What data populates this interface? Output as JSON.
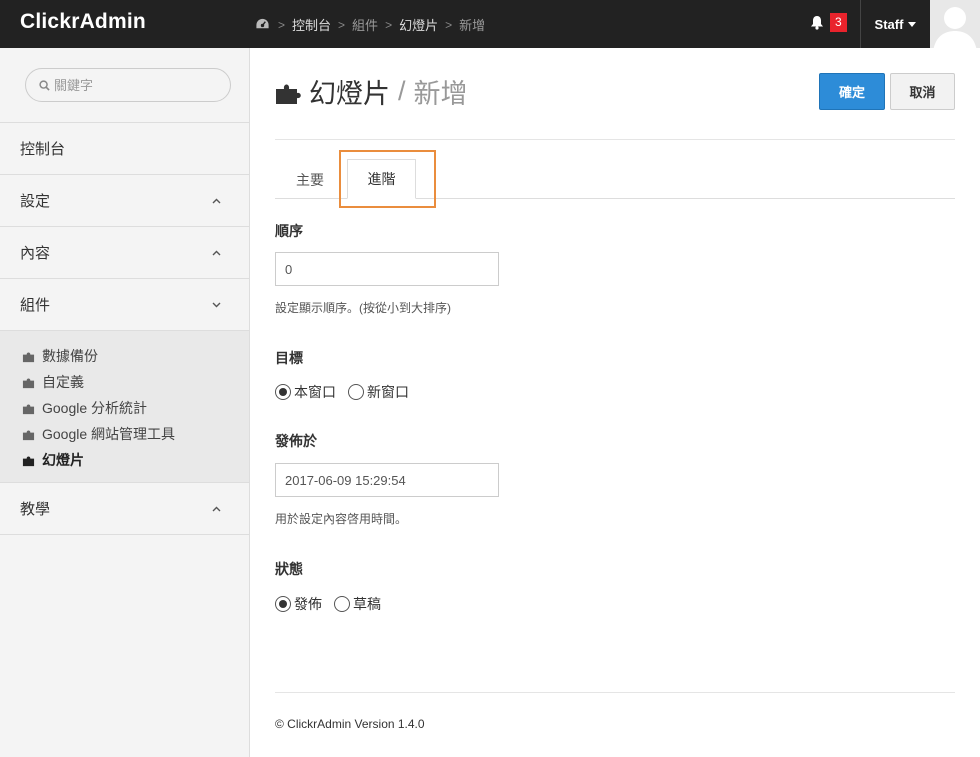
{
  "app": {
    "brand": "ClickrAdmin"
  },
  "breadcrumb": {
    "items": [
      "控制台",
      "組件",
      "幻燈片",
      "新增"
    ]
  },
  "notifications": {
    "count": "3"
  },
  "user": {
    "name": "Staff"
  },
  "sidebar": {
    "search_placeholder": "關鍵字",
    "items": [
      {
        "label": "控制台",
        "chevron": ""
      },
      {
        "label": "設定",
        "chevron": "⌃"
      },
      {
        "label": "內容",
        "chevron": "⌃"
      },
      {
        "label": "組件",
        "chevron": "⌄"
      },
      {
        "label": "教學",
        "chevron": "⌃"
      }
    ],
    "sub_items": [
      "數據備份",
      "自定義",
      "Google 分析統計",
      "Google 網站管理工具",
      "幻燈片"
    ]
  },
  "page": {
    "title": "幻燈片",
    "separator": "/",
    "subtitle": "新增"
  },
  "actions": {
    "confirm": "確定",
    "cancel": "取消"
  },
  "tabs": [
    "主要",
    "進階"
  ],
  "form": {
    "order": {
      "label": "順序",
      "value": "0",
      "help": "設定顯示順序。(按從小到大排序)"
    },
    "target": {
      "label": "目標",
      "options": [
        "本窗口",
        "新窗口"
      ],
      "selected": "本窗口"
    },
    "published_at": {
      "label": "發佈於",
      "value": "2017-06-09 15:29:54",
      "help": "用於設定內容啓用時間。"
    },
    "status": {
      "label": "狀態",
      "options": [
        "發佈",
        "草稿"
      ],
      "selected": "發佈"
    }
  },
  "footer": {
    "text": "© ClickrAdmin Version 1.4.0"
  },
  "colors": {
    "topbar": "#222222",
    "primary": "#2d8cd8",
    "badge": "#e9232c",
    "highlight": "#ea8d3d"
  }
}
